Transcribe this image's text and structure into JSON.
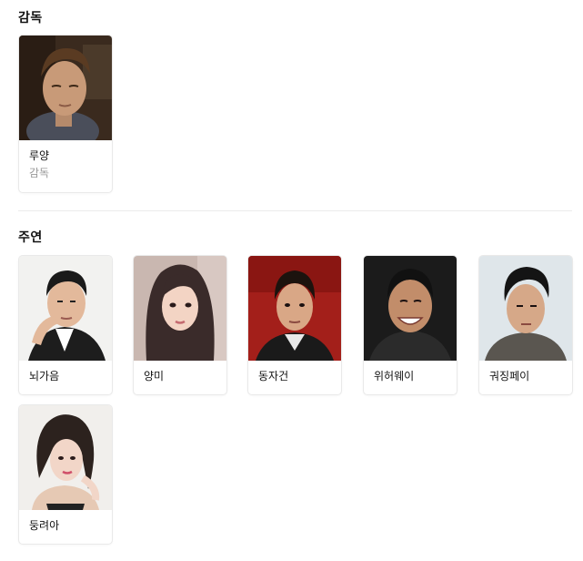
{
  "sections": {
    "director": {
      "title": "감독",
      "people": [
        {
          "name": "루양",
          "role": "감독"
        }
      ]
    },
    "cast": {
      "title": "주연",
      "people": [
        {
          "name": "뇌가음"
        },
        {
          "name": "양미"
        },
        {
          "name": "동자건"
        },
        {
          "name": "위허웨이"
        },
        {
          "name": "궈징페이"
        },
        {
          "name": "둥려아"
        }
      ]
    }
  }
}
